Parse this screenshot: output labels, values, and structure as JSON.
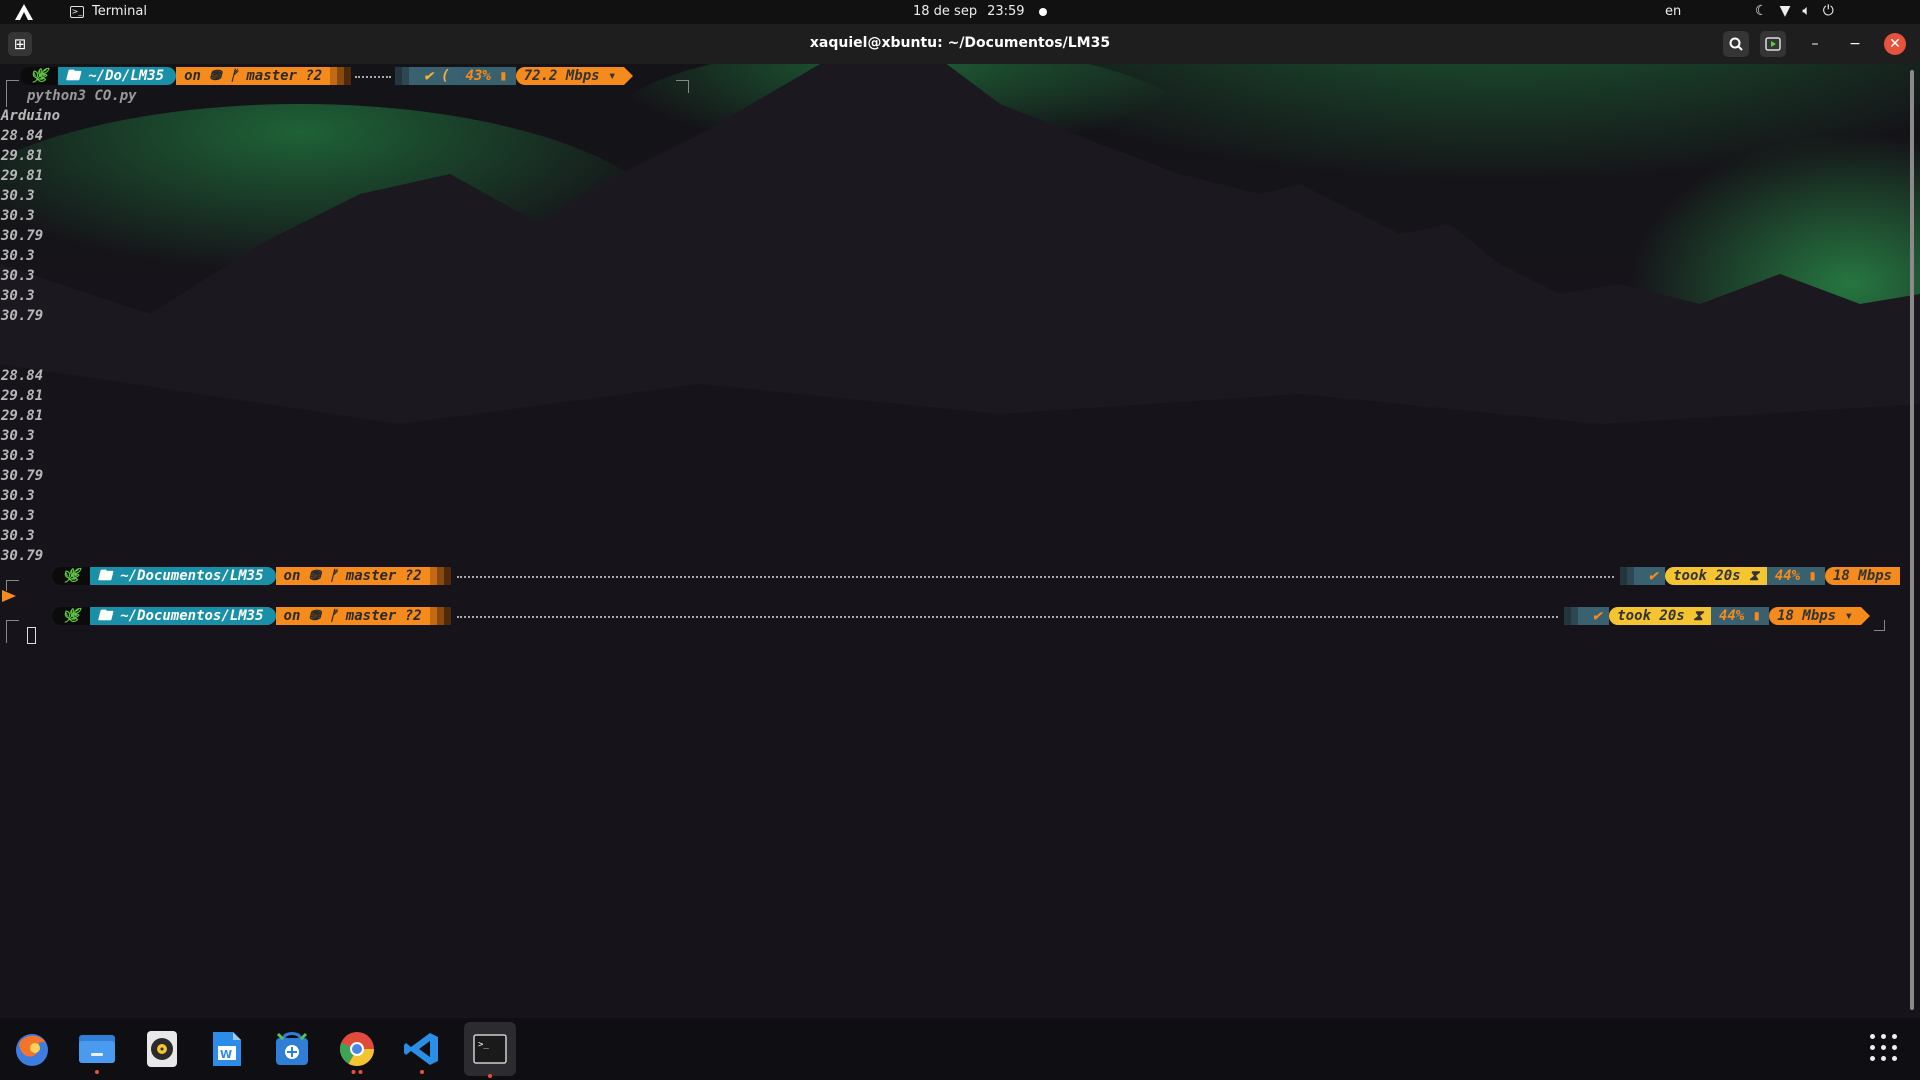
{
  "topbar": {
    "activity_label": "Terminal",
    "date": "18 de sep",
    "time": "23:59",
    "keyboard_layout": "en",
    "tray_icons": [
      "night-light-icon",
      "wifi-icon",
      "volume-icon",
      "power-icon"
    ]
  },
  "window": {
    "title": "xaquiel@xbuntu: ~/Documentos/LM35",
    "buttons": [
      "search-icon",
      "cast-icon",
      "minimize-icon",
      "maximize-icon",
      "close-icon"
    ]
  },
  "terminal": {
    "prompt1": {
      "path": "~/Do/LM35",
      "git": "on ⛃ ᚠ master ?2",
      "status": "✔ (",
      "battery": "43%",
      "net": "72.2 Mbps"
    },
    "command": "python3 CO.py",
    "output_lines": [
      "Arduino",
      "28.84",
      "29.81",
      "29.81",
      "30.3",
      "30.3",
      "30.79",
      "30.3",
      "30.3",
      "30.3",
      "30.79",
      "",
      "",
      "28.84",
      "29.81",
      "29.81",
      "30.3",
      "30.3",
      "30.79",
      "30.3",
      "30.3",
      "30.3",
      "30.79"
    ],
    "prompt2": {
      "path": "~/Documentos/LM35",
      "git": "on ⛃ ᚠ master ?2",
      "status": "✔",
      "took": "took 20s ⧗",
      "battery": "44%",
      "net": "18 Mbps"
    },
    "prompt3": {
      "path": "~/Documentos/LM35",
      "git": "on ⛃ ᚠ master ?2",
      "status": "✔",
      "took": "took 20s ⧗",
      "battery": "44%",
      "net": "18 Mbps"
    }
  },
  "dock": {
    "apps": [
      {
        "name": "firefox",
        "running": false
      },
      {
        "name": "files",
        "running": true
      },
      {
        "name": "rhythmbox",
        "running": false
      },
      {
        "name": "writer",
        "running": false
      },
      {
        "name": "software",
        "running": false
      },
      {
        "name": "chrome",
        "running": true
      },
      {
        "name": "vscode",
        "running": true
      },
      {
        "name": "terminal",
        "running": true
      }
    ]
  },
  "colors": {
    "accent_orange": "#f48b1c",
    "path_blue": "#1a8fa8",
    "took_yellow": "#f4c431",
    "close_red": "#e6533c"
  }
}
